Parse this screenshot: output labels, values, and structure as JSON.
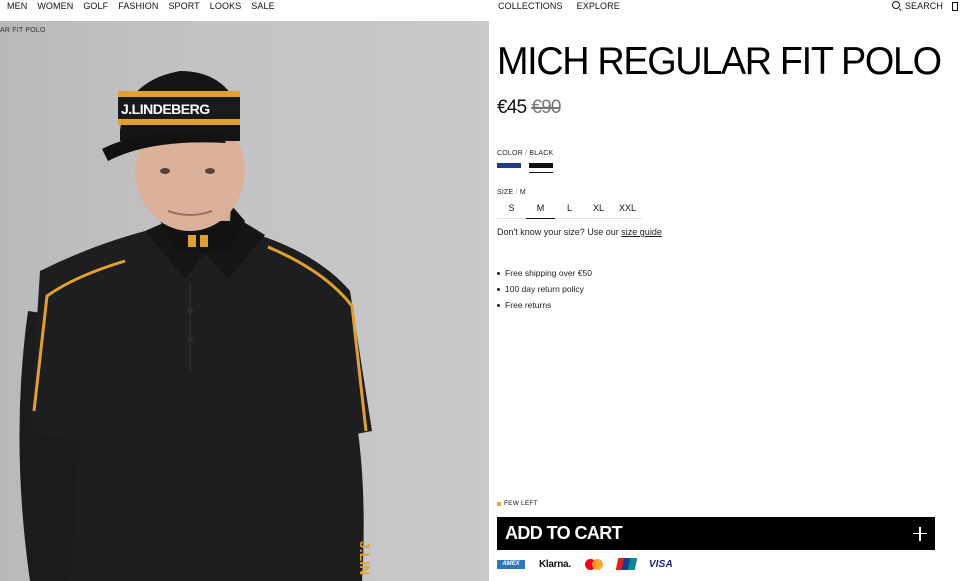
{
  "nav": {
    "left": [
      "MEN",
      "WOMEN",
      "GOLF",
      "FASHION",
      "SPORT",
      "LOOKS",
      "SALE"
    ],
    "middle": [
      "COLLECTIONS",
      "EXPLORE"
    ],
    "search_label": "SEARCH"
  },
  "image": {
    "caption": "AR FIT POLO",
    "cap_logo_text": "J.LINDEBERG",
    "sleeve_text": "J.LIN",
    "background_color": "#c3c3c5"
  },
  "product": {
    "title": "MICH REGULAR FIT POLO",
    "price_current": "€45",
    "price_original": "€90",
    "color_label": "COLOR",
    "color_sep": "/",
    "color_value": "BLACK",
    "colors": [
      {
        "name": "blue",
        "hex": "#1f3a8a"
      },
      {
        "name": "black",
        "hex": "#111111"
      }
    ],
    "size_label": "SIZE",
    "size_sep": "/",
    "size_value": "M",
    "sizes": [
      "S",
      "M",
      "L",
      "XL",
      "XXL"
    ],
    "size_help_text": "Don't know your size? Use our",
    "size_help_link": "size guide",
    "usps": [
      "Free shipping over €50",
      "100 day return policy",
      "Free returns"
    ],
    "stock_text": "FEW LEFT",
    "stock_color": "#e6a72b",
    "cart_label": "ADD TO CART"
  },
  "payments": {
    "amex": "AMEX",
    "klarna": "Klarna.",
    "mastercard": "mastercard-icon",
    "unionpay": "unionpay-icon",
    "visa": "VISA"
  }
}
